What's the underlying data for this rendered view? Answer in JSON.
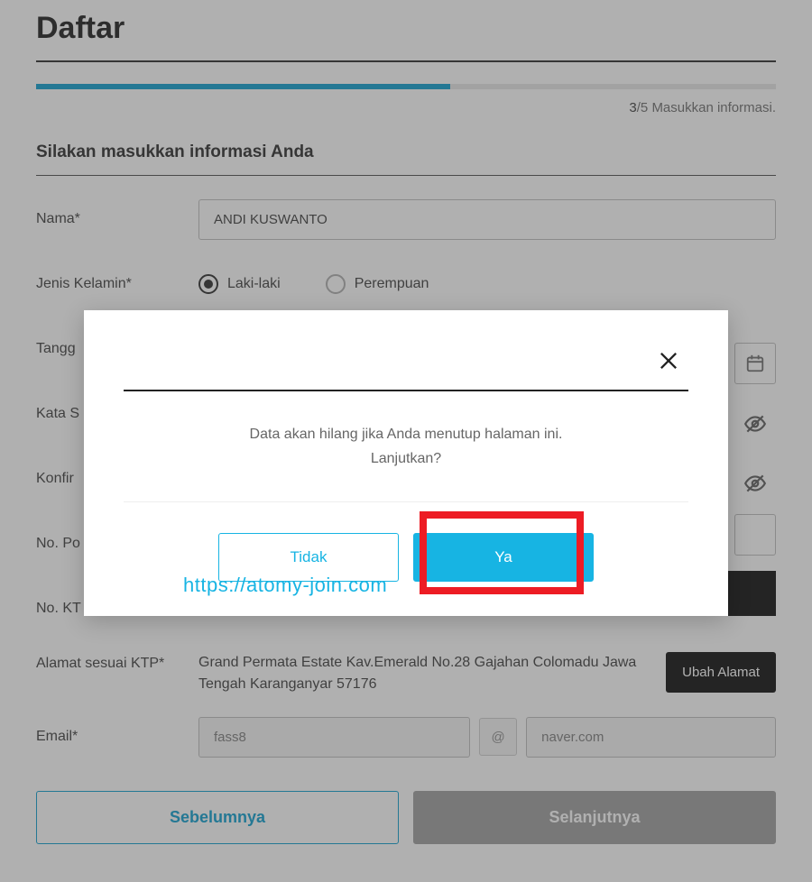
{
  "page": {
    "title": "Daftar",
    "progress": {
      "current": "3",
      "sep": "/",
      "total": "5",
      "label": "Masukkan informasi."
    },
    "section_heading": "Silakan masukkan informasi Anda"
  },
  "fields": {
    "name": {
      "label": "Nama*",
      "value": "ANDI KUSWANTO"
    },
    "gender": {
      "label": "Jenis Kelamin*",
      "male": "Laki-laki",
      "female": "Perempuan"
    },
    "dob": {
      "label": "Tangg"
    },
    "password": {
      "label": "Kata S"
    },
    "confirm": {
      "label": "Konfir"
    },
    "phone": {
      "label": "No. Po"
    },
    "ktp_no": {
      "label": "No. KT"
    },
    "address": {
      "label": "Alamat sesuai KTP*",
      "value": "Grand Permata Estate Kav.Emerald No.28 Gajahan Colomadu Jawa Tengah Karanganyar 57176",
      "button": "Ubah Alamat"
    },
    "email": {
      "label": "Email*",
      "local": "fass8",
      "at": "@",
      "domain": "naver.com"
    }
  },
  "buttons": {
    "prev": "Sebelumnya",
    "next": "Selanjutnya"
  },
  "modal": {
    "line1": "Data akan hilang jika Anda menutup halaman ini.",
    "line2": "Lanjutkan?",
    "no": "Tidak",
    "yes": "Ya"
  },
  "watermark": "https://atomy-join.com"
}
